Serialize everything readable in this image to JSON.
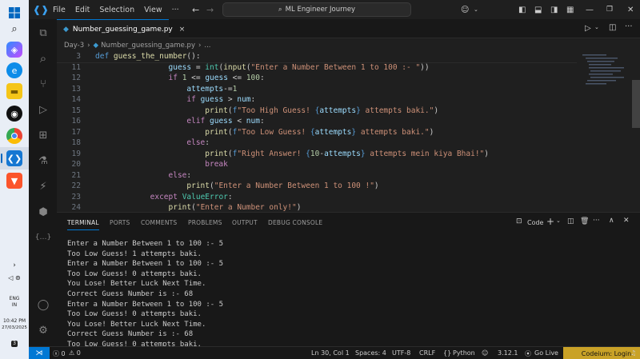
{
  "titlebar": {
    "menus": [
      "File",
      "Edit",
      "Selection",
      "View",
      "···"
    ],
    "search_text": "ML Engineer Journey"
  },
  "tab": {
    "label": "Number_guessing_game.py",
    "close": "×"
  },
  "breadcrumb": {
    "folder": "Day-3",
    "file": "Number_guessing_game.py",
    "more": "..."
  },
  "code_lines": [
    {
      "ln": "3",
      "indent": 0,
      "html": "<span class='kw2'>def</span> <span class='fn'>guess_the_number</span>():"
    },
    {
      "ln": "11",
      "indent": 4,
      "html": "<span class='var'>guess</span> = <span class='bi'>int</span>(<span class='fn'>input</span>(<span class='str'>\"Enter a Number Between 1 to 100 :- \"</span>))"
    },
    {
      "ln": "12",
      "indent": 4,
      "html": "<span class='kw'>if</span> <span class='num'>1</span> &lt;= <span class='var'>guess</span> &lt;= <span class='num'>100</span>:"
    },
    {
      "ln": "13",
      "indent": 5,
      "html": "<span class='var'>attempts</span>-=<span class='num'>1</span>"
    },
    {
      "ln": "14",
      "indent": 5,
      "html": "<span class='kw'>if</span> <span class='var'>guess</span> &gt; <span class='var'>num</span>:"
    },
    {
      "ln": "15",
      "indent": 6,
      "html": "<span class='fn'>print</span>(<span class='kw2'>f</span><span class='str'>\"Too High Guess! </span><span class='brace'>{</span><span class='var'>attempts</span><span class='brace'>}</span><span class='str'> attempts baki.\"</span>)"
    },
    {
      "ln": "16",
      "indent": 5,
      "html": "<span class='kw'>elif</span> <span class='var'>guess</span> &lt; <span class='var'>num</span>:"
    },
    {
      "ln": "17",
      "indent": 6,
      "html": "<span class='fn'>print</span>(<span class='kw2'>f</span><span class='str'>\"Too Low Guess! </span><span class='brace'>{</span><span class='var'>attempts</span><span class='brace'>}</span><span class='str'> attempts baki.\"</span>)"
    },
    {
      "ln": "18",
      "indent": 5,
      "html": "<span class='kw'>else</span>:"
    },
    {
      "ln": "19",
      "indent": 6,
      "html": "<span class='fn'>print</span>(<span class='kw2'>f</span><span class='str'>\"Right Answer! </span><span class='brace'>{</span><span class='num'>10</span>-<span class='var'>attempts</span><span class='brace'>}</span><span class='str'> attempts mein kiya Bhai!\"</span>)"
    },
    {
      "ln": "20",
      "indent": 6,
      "html": "<span class='kw'>break</span>"
    },
    {
      "ln": "21",
      "indent": 4,
      "html": "<span class='kw'>else</span>:"
    },
    {
      "ln": "22",
      "indent": 5,
      "html": "<span class='fn'>print</span>(<span class='str'>\"Enter a Number Between 1 to 100 !\"</span>)"
    },
    {
      "ln": "23",
      "indent": 3,
      "html": "<span class='kw'>except</span> <span class='bi'>ValueError</span>:"
    },
    {
      "ln": "24",
      "indent": 4,
      "html": "<span class='fn'>print</span>(<span class='str'>\"Enter a Number only!\"</span>)"
    }
  ],
  "panel": {
    "tabs": [
      "TERMINAL",
      "PORTS",
      "COMMENTS",
      "PROBLEMS",
      "OUTPUT",
      "DEBUG CONSOLE"
    ],
    "shell_label": "Code",
    "terminal_lines": [
      "Enter a Number Between 1 to 100 :- 5",
      "Too Low Guess! 1 attempts baki.",
      "Enter a Number Between 1 to 100 :- 5",
      "Too Low Guess! 0 attempts baki.",
      "You Lose! Better Luck Next Time.",
      "Correct Guess Number is :- 68",
      "Enter a Number Between 1 to 100 :- 5",
      "Too Low Guess! 0 attempts baki.",
      "You Lose! Better Luck Next Time.",
      "Correct Guess Number is :- 68",
      "Too Low Guess! 0 attempts baki."
    ]
  },
  "statusbar": {
    "errors": "ⓧ 0",
    "warnings": "⚠ 0",
    "position": "Ln 30, Col 1",
    "spaces": "Spaces: 4",
    "encoding": "UTF-8",
    "eol": "CRLF",
    "language": "Python",
    "version": "3.12.1",
    "golive": "Go Live",
    "codeium": "Codeium: Login"
  },
  "taskbar": {
    "lang": "ENG",
    "region": "IN",
    "time": "10:42 PM",
    "date": "27/03/2025",
    "notif": "3"
  }
}
